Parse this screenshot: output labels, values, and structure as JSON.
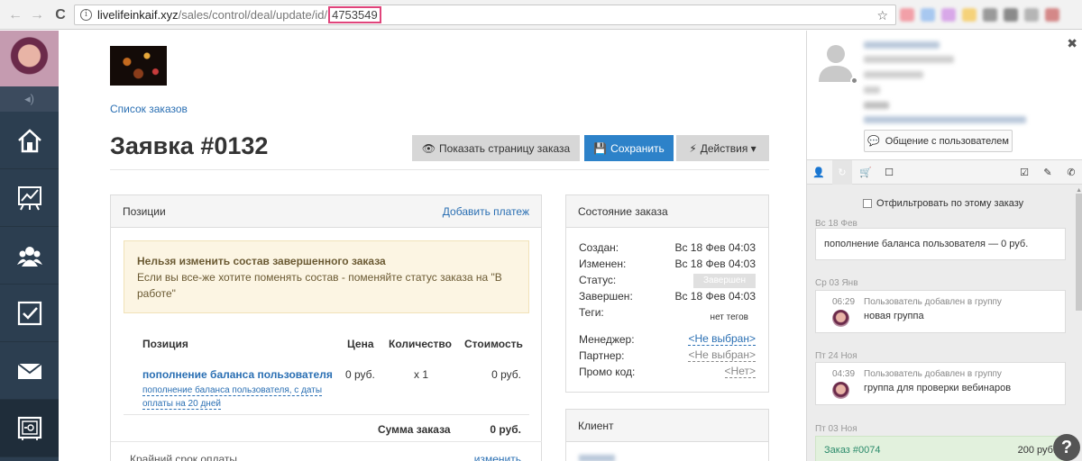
{
  "browser": {
    "url_host": "livelifeinkaif.xyz",
    "url_path": "/sales/control/deal/update/id/",
    "url_id": "4753549",
    "info_icon": "i",
    "back_glyph": "←",
    "forward_glyph": "→",
    "reload_glyph": "C",
    "star_glyph": "☆",
    "extension_colors": [
      "#f2a0a8",
      "#a8c8f0",
      "#d8a8e8",
      "#f5d27a",
      "#9a9a9a",
      "#8a8a8a",
      "#b5b5b5",
      "#d48888"
    ]
  },
  "sidebar": {
    "sub_icon": "◂)",
    "items": [
      {
        "icon": "home-icon"
      },
      {
        "icon": "chart-icon"
      },
      {
        "icon": "users-icon"
      },
      {
        "icon": "tasks-icon"
      },
      {
        "icon": "mail-icon"
      },
      {
        "icon": "safe-icon"
      }
    ]
  },
  "header": {
    "orders_link": "Список заказов",
    "title": "Заявка #0132",
    "btn_show_order": "Показать страницу заказа",
    "btn_save": "Сохранить",
    "btn_actions": "Действия ▾",
    "btn_show_icon": "👁",
    "btn_save_icon": "💾",
    "btn_actions_icon": "⚡"
  },
  "positions": {
    "title": "Позиции",
    "add_payment": "Добавить платеж",
    "warn_title": "Нельзя изменить состав завершенного заказа",
    "warn_text": "Если вы все-же хотите поменять состав - поменяйте статус заказа на \"В работе\"",
    "col_position": "Позиция",
    "col_price": "Цена",
    "col_qty": "Количество",
    "col_cost": "Стоимость",
    "item_name": "пополнение баланса пользователя",
    "item_price": "0 руб.",
    "item_qty": "x 1",
    "item_cost": "0 руб.",
    "item_sub_line1": "пополнение баланса пользователя, с даты",
    "item_sub_line2": "оплаты на 20 дней",
    "sum_label": "Сумма заказа",
    "sum_value": "0 руб.",
    "deadline_label": "Крайний срок оплаты",
    "deadline_change": "изменить"
  },
  "order_state": {
    "title": "Состояние заказа",
    "created_label": "Создан:",
    "created_value": "Вс 18 Фев 04:03",
    "changed_label": "Изменен:",
    "changed_value": "Вс 18 Фев 04:03",
    "status_label": "Статус:",
    "status_value": "Завершен",
    "finished_label": "Завершен:",
    "finished_value": "Вс 18 Фев 04:03",
    "tags_label": "Теги:",
    "tags_value": "нет тегов",
    "manager_label": "Менеджер:",
    "manager_value": "<Не выбран>",
    "partner_label": "Партнер:",
    "partner_value": "<Не выбран>",
    "promo_label": "Промо код:",
    "promo_value": "<Нет>"
  },
  "client": {
    "title": "Клиент"
  },
  "right_panel": {
    "chat_button": "Общение с пользователем",
    "chat_icon": "💬",
    "close_glyph": "✖",
    "filter_label": "Отфильтровать по этому заказу",
    "tabs": [
      "👤",
      "↻",
      "🛒",
      "☐",
      "☑",
      "✎",
      "✆"
    ],
    "feed": [
      {
        "date": "Вс 18 Фев",
        "text": "пополнение баланса пользователя — 0 руб."
      },
      {
        "date": "Ср 03 Янв",
        "time": "06:29",
        "meta": "Пользователь добавлен в группу",
        "text": "новая группа"
      },
      {
        "date": "Пт 24 Ноя",
        "time": "04:39",
        "meta": "Пользователь добавлен в группу",
        "text": "группа для проверки вебинаров"
      },
      {
        "date": "Пт 03 Ноя",
        "order": "Заказ #0074",
        "amount": "200 руб."
      }
    ],
    "help": "?"
  }
}
